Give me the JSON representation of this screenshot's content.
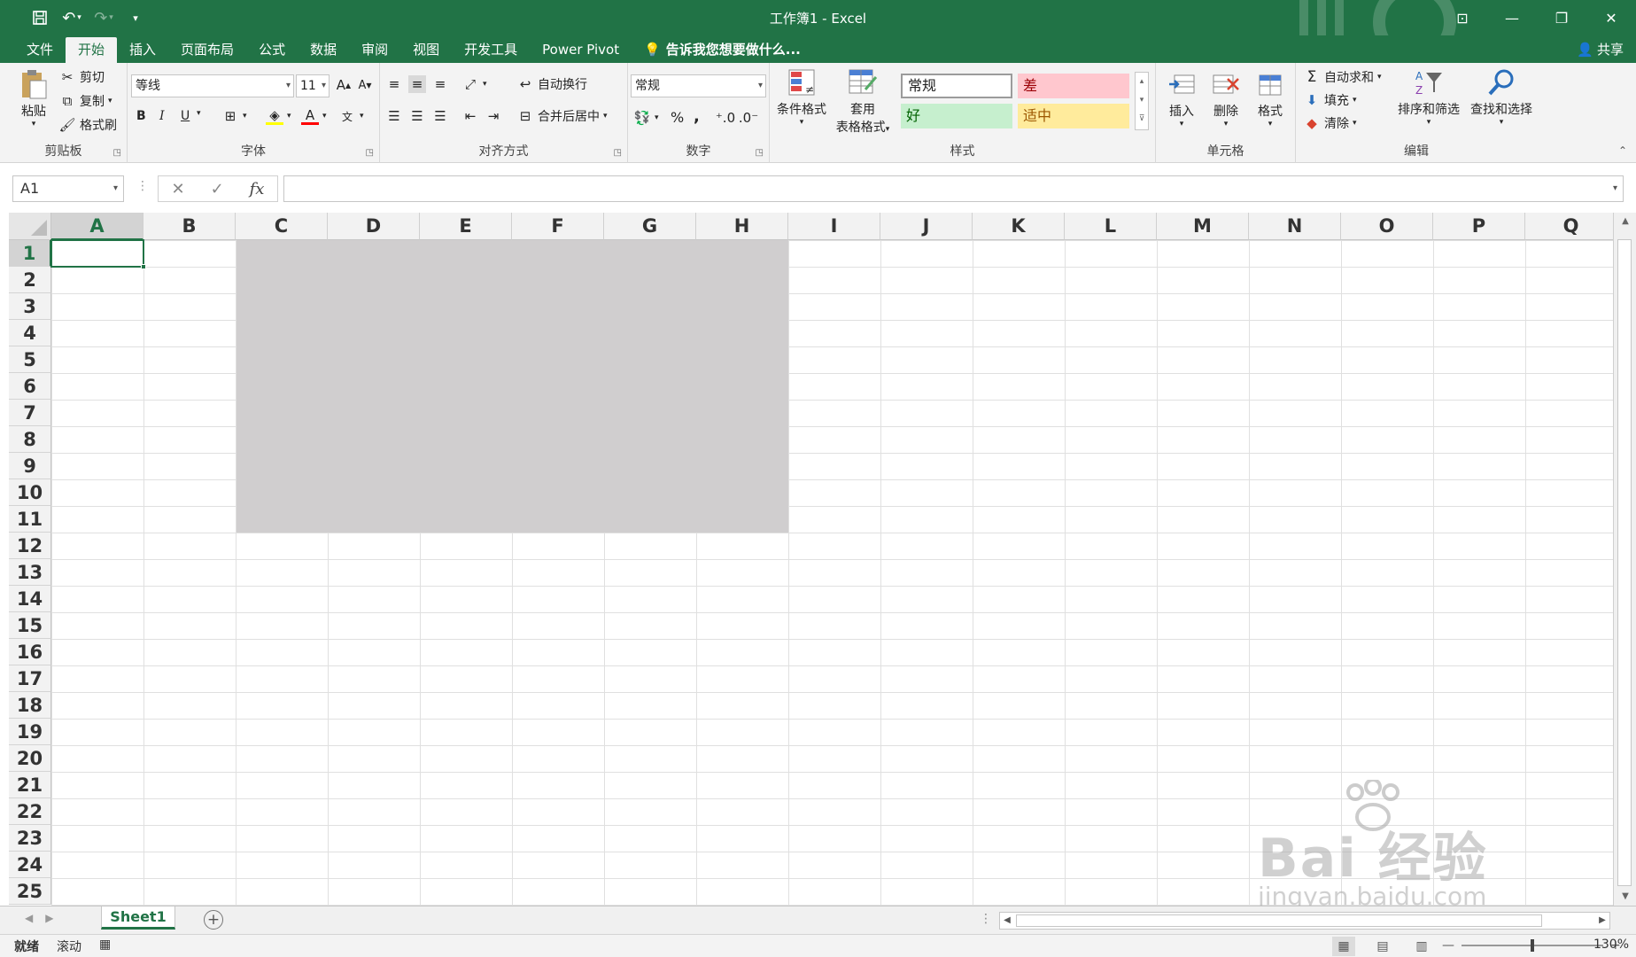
{
  "window": {
    "title": "工作簿1 - Excel"
  },
  "qat": {
    "save_icon": "save-icon",
    "undo_icon": "undo-icon",
    "redo_icon": "redo-icon",
    "customize_icon": "customize-icon"
  },
  "tabs": [
    {
      "label": "文件"
    },
    {
      "label": "开始"
    },
    {
      "label": "插入"
    },
    {
      "label": "页面布局"
    },
    {
      "label": "公式"
    },
    {
      "label": "数据"
    },
    {
      "label": "审阅"
    },
    {
      "label": "视图"
    },
    {
      "label": "开发工具"
    },
    {
      "label": "Power Pivot"
    }
  ],
  "tell_me": "告诉我您想要做什么...",
  "share": "共享",
  "ribbon": {
    "clipboard": {
      "label": "剪贴板",
      "paste": "粘贴",
      "cut": "剪切",
      "copy": "复制",
      "format_painter": "格式刷"
    },
    "font": {
      "label": "字体",
      "font_name": "等线",
      "font_size": "11",
      "bold": "B",
      "italic": "I",
      "underline": "U"
    },
    "alignment": {
      "label": "对齐方式",
      "wrap_text": "自动换行",
      "merge_center": "合并后居中"
    },
    "number": {
      "label": "数字",
      "format": "常规",
      "percent": "%",
      "comma": ","
    },
    "styles": {
      "label": "样式",
      "conditional": "条件格式",
      "table_format_1": "套用",
      "table_format_2": "表格格式",
      "normal": "常规",
      "bad": "差",
      "good": "好",
      "neutral": "适中"
    },
    "cells": {
      "label": "单元格",
      "insert": "插入",
      "delete": "删除",
      "format": "格式"
    },
    "editing": {
      "label": "编辑",
      "autosum": "自动求和",
      "fill": "填充",
      "clear": "清除",
      "sort_filter": "排序和筛选",
      "find_select": "查找和选择"
    }
  },
  "formula_bar": {
    "name_box": "A1",
    "fx": "fx",
    "value": ""
  },
  "grid": {
    "columns": [
      "A",
      "B",
      "C",
      "D",
      "E",
      "F",
      "G",
      "H",
      "I",
      "J",
      "K",
      "L",
      "M",
      "N",
      "O",
      "P",
      "Q"
    ],
    "rows": [
      "1",
      "2",
      "3",
      "4",
      "5",
      "6",
      "7",
      "8",
      "9",
      "10",
      "11",
      "12",
      "13",
      "14",
      "15",
      "16",
      "17",
      "18",
      "19",
      "20",
      "21",
      "22",
      "23",
      "24",
      "25"
    ],
    "active_cell": "A1",
    "shaded_range": "C1:H11",
    "shade_color": "#d0cecf"
  },
  "sheets": [
    {
      "name": "Sheet1",
      "active": true
    }
  ],
  "status": {
    "ready": "就绪",
    "scroll": "滚动",
    "zoom": "130%"
  },
  "watermark": {
    "brand": "Bai 经验",
    "url": "jingyan.baidu.com"
  },
  "colors": {
    "accent": "#217346",
    "style_bad_bg": "#ffc7ce",
    "style_bad_fg": "#9c0006",
    "style_good_bg": "#c6efce",
    "style_good_fg": "#006100",
    "style_neutral_bg": "#ffeb9c",
    "style_neutral_fg": "#9c5700"
  }
}
